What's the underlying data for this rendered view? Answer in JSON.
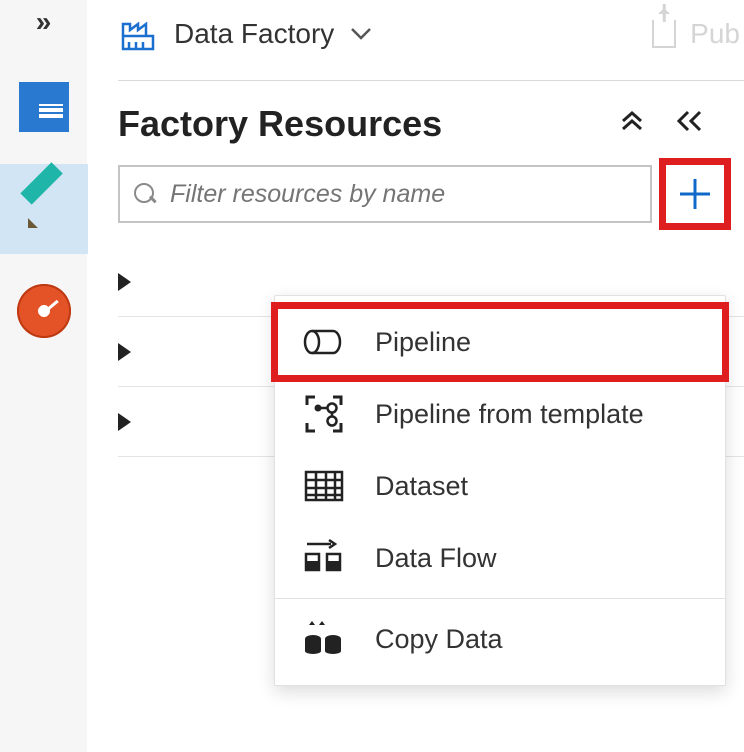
{
  "top": {
    "dropdown_label": "Data Factory",
    "publish_label": "Pub"
  },
  "resources": {
    "title": "Factory Resources",
    "filter_placeholder": "Filter resources by name"
  },
  "add_menu": {
    "items": [
      {
        "label": "Pipeline"
      },
      {
        "label": "Pipeline from template"
      },
      {
        "label": "Dataset"
      },
      {
        "label": "Data Flow"
      },
      {
        "label": "Copy Data"
      }
    ]
  }
}
